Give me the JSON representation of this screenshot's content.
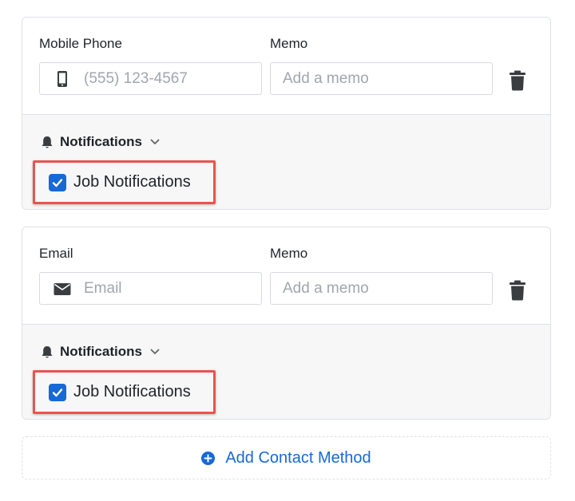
{
  "contact_methods": [
    {
      "type_label": "Mobile Phone",
      "type_icon": "mobile-phone-icon",
      "value": "",
      "placeholder": "(555) 123-4567",
      "memo_label": "Memo",
      "memo_value": "",
      "memo_placeholder": "Add a memo",
      "notifications_label": "Notifications",
      "job_notifications_label": "Job Notifications",
      "job_notifications_checked": true
    },
    {
      "type_label": "Email",
      "type_icon": "envelope-icon",
      "value": "",
      "placeholder": "Email",
      "memo_label": "Memo",
      "memo_value": "",
      "memo_placeholder": "Add a memo",
      "notifications_label": "Notifications",
      "job_notifications_label": "Job Notifications",
      "job_notifications_checked": true
    }
  ],
  "add_contact_method_label": "Add Contact Method",
  "colors": {
    "accent": "#1769d6",
    "highlight_border": "#e8554e",
    "panel_background": "#f7f7f7",
    "card_border": "#dde1e6",
    "icon_gray": "#3a3d40"
  }
}
